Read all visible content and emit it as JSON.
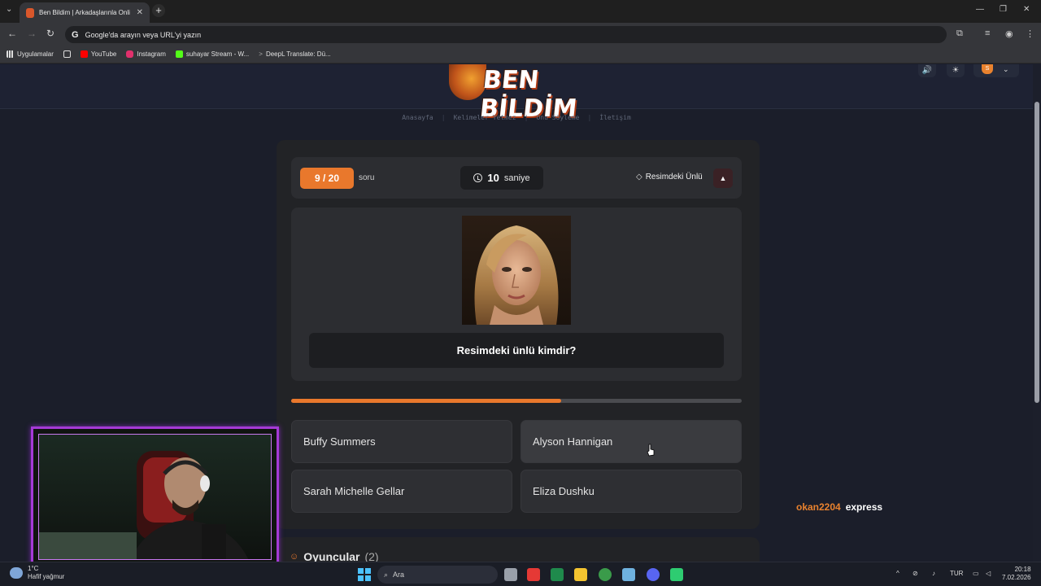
{
  "browser": {
    "tab_title": "Ben Bildim | Arkadaşlarınla Onli",
    "address_placeholder": "Google'da arayın veya URL'yi yazın",
    "bookmarks": [
      {
        "label": "Uygulamalar",
        "icon": "apps-grid-icon",
        "color": "#e8e8e8"
      },
      {
        "label": "",
        "icon": "grid-icon",
        "color": "#e8e8e8"
      },
      {
        "label": "YouTube",
        "icon": "youtube-icon",
        "color": "#ff0000"
      },
      {
        "label": "Instagram",
        "icon": "instagram-icon",
        "color": "#e1306c"
      },
      {
        "label": "suhayar Stream - W...",
        "icon": "kick-icon",
        "color": "#53fc18"
      },
      {
        "label": "DeepL Translate: Dü...",
        "icon": "deepl-icon",
        "color": "#0f2b46"
      }
    ]
  },
  "site": {
    "logo_text": "BEN BİLDİM",
    "nav": [
      "Anasayfa",
      "Kelimeler Yetmez",
      "Onu Söyleme",
      "İletişim"
    ],
    "user_initial": "S"
  },
  "game": {
    "question_counter": "9 / 20",
    "question_label": "soru",
    "timer_value": "10",
    "timer_unit": "saniye",
    "category": "Resimdeki Ünlü",
    "question_text": "Resimdeki ünlü kimdir?",
    "progress": 0.6,
    "options": [
      "Buffy Summers",
      "Alyson Hannigan",
      "Sarah Michelle Gellar",
      "Eliza Dushku"
    ],
    "players_title": "Oyuncular",
    "players_count": "(2)"
  },
  "chat": {
    "user": "okan2204",
    "message": "express"
  },
  "taskbar": {
    "weather_temp": "1°C",
    "weather_desc": "Hafif yağmur",
    "search_placeholder": "Ara",
    "lang": "TUR",
    "time": "20:18",
    "date": "7.02.2026"
  },
  "colors": {
    "accent": "#e9782c",
    "webcam_frame": "#a53ad6"
  }
}
